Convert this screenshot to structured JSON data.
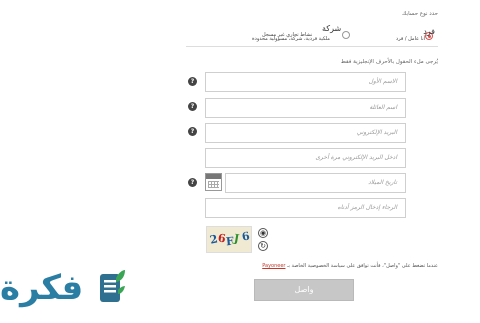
{
  "account_type": {
    "title": "حدد نوع حسابك",
    "options": [
      {
        "label": "فرد",
        "description": "أنا عامل / فرد",
        "selected": true
      },
      {
        "label": "شركة",
        "description": "ملكية فردية، شركة، مسؤولية محدودة",
        "selected": false
      }
    ],
    "middle_text": "نشاط تجاري غير مسجل"
  },
  "form": {
    "note": "يُرجى ملء الحقول بالأحرف الإنجليزية فقط",
    "fields": {
      "first_name": "الاسم الأول",
      "last_name": "اسم العائلة",
      "email": "البريد الإلكتروني",
      "email_confirm": "ادخل البريد الإلكتروني مرة أخرى",
      "birth_date": "تاريخ الميلاد",
      "captcha_input": "الرجاء إدخال الرمز أدناه"
    },
    "help_glyph": "?",
    "captcha": {
      "chars": [
        "2",
        "6",
        "F",
        "J",
        "6"
      ],
      "colors": [
        "#1a5a9c",
        "#c02020",
        "#1a5a9c",
        "#2f8f2f",
        "#1a5a9c"
      ]
    },
    "terms": {
      "text": "عندما تضغط على \"واصل\"، فأنت توافق على سياسة الخصوصية الخاصة بـ",
      "link": "Payoneer"
    },
    "submit_label": "واصل"
  },
  "brand": {
    "logo_text": "فكرة",
    "colors": {
      "logo": "#2a7da3",
      "leaf": "#3aa655",
      "book": "#2f6f8f"
    }
  }
}
